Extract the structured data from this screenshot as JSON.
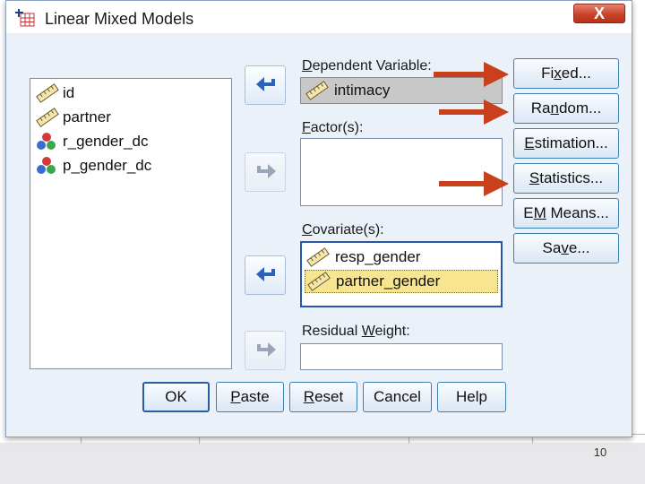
{
  "window": {
    "title": "Linear Mixed Models",
    "close_glyph": "X"
  },
  "source_variables": [
    {
      "label": "id",
      "icon": "scale-ruler-icon"
    },
    {
      "label": "partner",
      "icon": "scale-ruler-icon"
    },
    {
      "label": "r_gender_dc",
      "icon": "nominal-balls-icon"
    },
    {
      "label": "p_gender_dc",
      "icon": "nominal-balls-icon"
    }
  ],
  "dependent": {
    "label_u": "D",
    "label_rest": "ependent Variable:",
    "value": "intimacy"
  },
  "factors": {
    "label_u": "F",
    "label_rest": "actor(s):"
  },
  "covariates": {
    "label_u": "C",
    "label_rest": "ovariate(s):",
    "items": [
      "resp_gender",
      "partner_gender"
    ],
    "selected_index": 1
  },
  "residual_weight": {
    "label_pre": "Residual ",
    "label_u": "W",
    "label_rest": "eight:"
  },
  "side_buttons": {
    "fixed": {
      "pre": "Fi",
      "u": "x",
      "post": "ed..."
    },
    "random": {
      "pre": "Ra",
      "u": "n",
      "post": "dom..."
    },
    "estimation": {
      "pre": "",
      "u": "E",
      "post": "stimation..."
    },
    "statistics": {
      "pre": "",
      "u": "S",
      "post": "tatistics..."
    },
    "em_means": {
      "pre": "E",
      "u": "M",
      "post": " Means..."
    },
    "save": {
      "pre": "Sa",
      "u": "v",
      "post": "e..."
    }
  },
  "bottom_buttons": {
    "ok": {
      "pre": "OK",
      "u": "",
      "post": ""
    },
    "paste": {
      "pre": "",
      "u": "P",
      "post": "aste"
    },
    "reset": {
      "pre": "",
      "u": "R",
      "post": "eset"
    },
    "cancel": {
      "pre": "Cancel",
      "u": "",
      "post": ""
    },
    "help": {
      "pre": "Help",
      "u": "",
      "post": ""
    }
  },
  "slide": {
    "page_number": "10"
  },
  "colors": {
    "annotation_arrow": "#c8401c",
    "button_border": "#3c7fb1",
    "selection_highlight": "#f8e58f"
  }
}
